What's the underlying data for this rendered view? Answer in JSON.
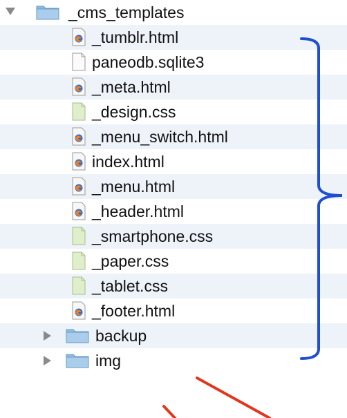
{
  "root": {
    "name": "_cms_templates",
    "expanded": true,
    "icon": "folder-icon",
    "children": [
      {
        "name": "_tumblr.html",
        "icon": "firefox-html-icon"
      },
      {
        "name": "paneodb.sqlite3",
        "icon": "blank-document-icon"
      },
      {
        "name": "_meta.html",
        "icon": "firefox-html-icon"
      },
      {
        "name": "_design.css",
        "icon": "css-document-icon"
      },
      {
        "name": "_menu_switch.html",
        "icon": "firefox-html-icon"
      },
      {
        "name": "index.html",
        "icon": "firefox-html-icon"
      },
      {
        "name": "_menu.html",
        "icon": "firefox-html-icon"
      },
      {
        "name": "_header.html",
        "icon": "firefox-html-icon"
      },
      {
        "name": "_smartphone.css",
        "icon": "css-document-icon"
      },
      {
        "name": "_paper.css",
        "icon": "css-document-icon"
      },
      {
        "name": "_tablet.css",
        "icon": "css-document-icon"
      },
      {
        "name": "_footer.html",
        "icon": "firefox-html-icon"
      }
    ]
  },
  "siblings": [
    {
      "name": "backup",
      "expanded": false,
      "icon": "folder-icon"
    },
    {
      "name": "img",
      "expanded": false,
      "icon": "folder-icon"
    }
  ],
  "colors": {
    "row_alt": "#eef3fa",
    "folder": "#8fbde0",
    "bracket": "#1f4fcf",
    "arrow": "#e0371f"
  }
}
